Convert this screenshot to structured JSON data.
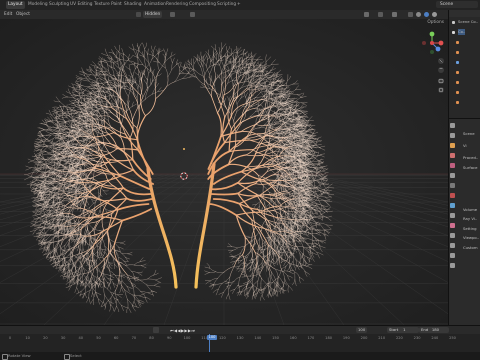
{
  "workspace_tabs": [
    "Layout",
    "Modeling",
    "Sculpting",
    "UV Editing",
    "Texture Paint",
    "Shading",
    "Animation",
    "Rendering",
    "Compositing",
    "Scripting"
  ],
  "active_tab": "Layout",
  "scene_name": "Scene",
  "viewport_header": {
    "mode": "Edit",
    "menu_object": "Object",
    "visibility_btn": "Hidden",
    "options": "Options"
  },
  "outliner": {
    "rows": [
      "Scene Co..",
      "Co..",
      "",
      "",
      "",
      "",
      "",
      "",
      ""
    ]
  },
  "properties": {
    "rows": [
      "Scene",
      "Vi",
      "Proced..",
      "Surface",
      "Volume",
      "Ray Vi..",
      "Setting",
      "Viewpo..",
      "Custom"
    ]
  },
  "timeline": {
    "current_frame": "100",
    "frame_field": "100",
    "start_label": "Start",
    "start_value": "1",
    "end_label": "End",
    "end_value": "180",
    "ticks": [
      "0",
      "10",
      "20",
      "30",
      "40",
      "50",
      "60",
      "70",
      "80",
      "90",
      "100",
      "110",
      "120",
      "130",
      "140",
      "150",
      "160",
      "170",
      "180",
      "190",
      "200",
      "210",
      "220",
      "230",
      "240",
      "250"
    ]
  },
  "status_bar": {
    "left": "Rotate View",
    "right": "Select"
  },
  "colors": {
    "accent": "#4d7fc4",
    "vein_light": "#f2d9c8",
    "vein_mid": "#e8a06a",
    "vein_root": "#f5c15a"
  }
}
